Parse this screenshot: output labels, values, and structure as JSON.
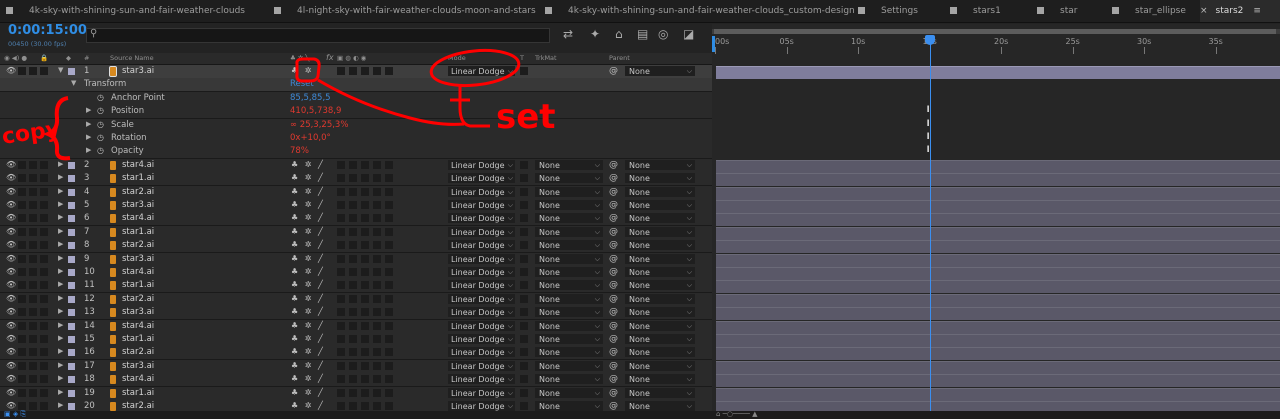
{
  "tabs": [
    {
      "label": "4k-sky-with-shining-sun-and-fair-weather-clouds",
      "active": false
    },
    {
      "label": "4l-night-sky-with-fair-weather-clouds-moon-and-stars",
      "active": false
    },
    {
      "label": "4k-sky-with-shining-sun-and-fair-weather-clouds_custom-design",
      "active": false
    },
    {
      "label": "Settings",
      "active": false
    },
    {
      "label": "stars1",
      "active": false
    },
    {
      "label": "star",
      "active": false
    },
    {
      "label": "star_ellipse",
      "active": false
    },
    {
      "label": "stars2",
      "active": true
    }
  ],
  "header": {
    "timecode": "0:00:15:00",
    "fps": "00450 (30.00 fps)",
    "search_icon": "search-icon"
  },
  "columns": {
    "hash": "#",
    "source_name": "Source Name",
    "fx": "fx",
    "mode": "Mode",
    "t": "T",
    "trkmat": "TrkMat",
    "parent": "Parent"
  },
  "ruler": {
    "labels": [
      "00s",
      "05s",
      "10s",
      "15s",
      "20s",
      "25s",
      "30s",
      "35s"
    ],
    "current_time_s": 15
  },
  "selected_layer": {
    "num": "1",
    "name": "star3.ai",
    "mode": "Linear Dodge",
    "parent": "None"
  },
  "transform": {
    "label": "Transform",
    "reset": "Reset",
    "properties": [
      {
        "name": "Anchor Point",
        "value": "85,5,85,5",
        "color": "#3e89d6"
      },
      {
        "name": "Position",
        "value": "410,5,738,9",
        "color": "#e0392f"
      },
      {
        "name": "Scale",
        "value": "∞ 25,3,25,3%",
        "color": "#e0392f"
      },
      {
        "name": "Rotation",
        "value": "0x+10,0°",
        "color": "#e0392f"
      },
      {
        "name": "Opacity",
        "value": "78%",
        "color": "#e0392f"
      }
    ]
  },
  "layers": [
    {
      "num": "2",
      "name": "star4.ai"
    },
    {
      "num": "3",
      "name": "star1.ai"
    },
    {
      "num": "4",
      "name": "star2.ai"
    },
    {
      "num": "5",
      "name": "star3.ai"
    },
    {
      "num": "6",
      "name": "star4.ai"
    },
    {
      "num": "7",
      "name": "star1.ai"
    },
    {
      "num": "8",
      "name": "star2.ai"
    },
    {
      "num": "9",
      "name": "star3.ai"
    },
    {
      "num": "10",
      "name": "star4.ai"
    },
    {
      "num": "11",
      "name": "star1.ai"
    },
    {
      "num": "12",
      "name": "star2.ai"
    },
    {
      "num": "13",
      "name": "star3.ai"
    },
    {
      "num": "14",
      "name": "star4.ai"
    },
    {
      "num": "15",
      "name": "star1.ai"
    },
    {
      "num": "16",
      "name": "star2.ai"
    },
    {
      "num": "17",
      "name": "star3.ai"
    },
    {
      "num": "18",
      "name": "star4.ai"
    },
    {
      "num": "19",
      "name": "star1.ai"
    },
    {
      "num": "20",
      "name": "star2.ai"
    }
  ],
  "layer_defaults": {
    "mode": "Linear Dodge",
    "trkmat": "None",
    "parent": "None"
  },
  "annotations": {
    "copy": "copy",
    "set": "set",
    "color": "#ff0000"
  }
}
